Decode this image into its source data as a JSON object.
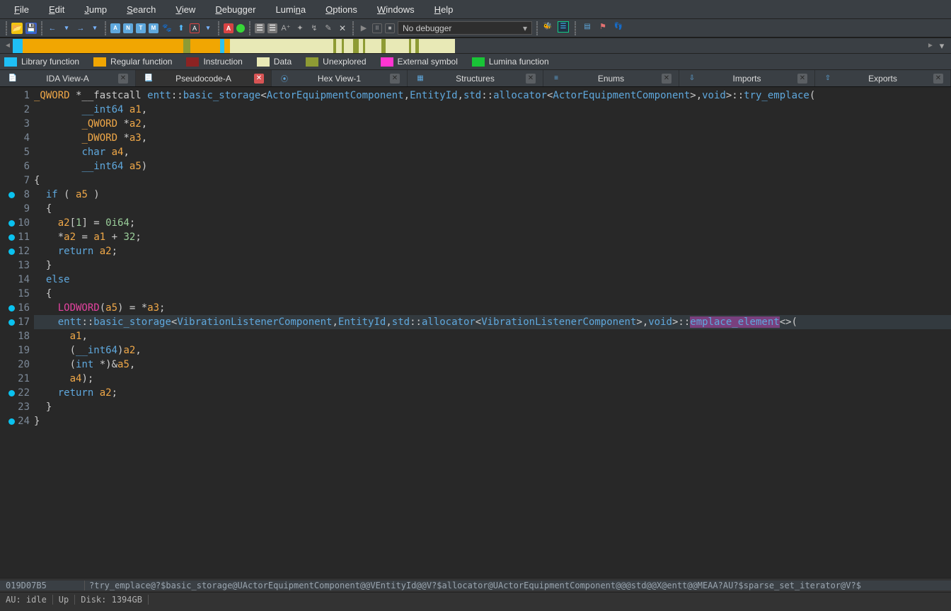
{
  "menu": [
    "File",
    "Edit",
    "Jump",
    "Search",
    "View",
    "Debugger",
    "Lumina",
    "Options",
    "Windows",
    "Help"
  ],
  "menuAccel": [
    0,
    0,
    0,
    0,
    0,
    0,
    4,
    0,
    0,
    0
  ],
  "debuggerField": "No debugger",
  "overview": [
    {
      "w": "2.2%",
      "c": "#1fbff5"
    },
    {
      "w": "35.2%",
      "c": "#f1a602"
    },
    {
      "w": "1.5%",
      "c": "#8e9b34"
    },
    {
      "w": "6.5%",
      "c": "#f1a602"
    },
    {
      "w": "1.0%",
      "c": "#2ec2f0"
    },
    {
      "w": "1.2%",
      "c": "#f1a602"
    },
    {
      "w": "22.7%",
      "c": "#e8e9b6"
    },
    {
      "w": "0.6%",
      "c": "#8e9b34"
    },
    {
      "w": "1.2%",
      "c": "#e8e9b6"
    },
    {
      "w": "0.5%",
      "c": "#8e9b34"
    },
    {
      "w": "2.0%",
      "c": "#e8e9b6"
    },
    {
      "w": "1.2%",
      "c": "#8e9b34"
    },
    {
      "w": "1.0%",
      "c": "#e8e9b6"
    },
    {
      "w": "0.5%",
      "c": "#8e9b34"
    },
    {
      "w": "3.5%",
      "c": "#e8e9b6"
    },
    {
      "w": "1.0%",
      "c": "#8e9b34"
    },
    {
      "w": "5.0%",
      "c": "#e8e9b6"
    },
    {
      "w": "0.5%",
      "c": "#8e9b34"
    },
    {
      "w": "1.0%",
      "c": "#e8e9b6"
    },
    {
      "w": "0.7%",
      "c": "#8e9b34"
    },
    {
      "w": "8.0%",
      "c": "#e8e9b6"
    }
  ],
  "legend": [
    {
      "c": "#1fbff5",
      "t": "Library function"
    },
    {
      "c": "#f1a602",
      "t": "Regular function"
    },
    {
      "c": "#8c2323",
      "t": "Instruction"
    },
    {
      "c": "#e8e9b6",
      "t": "Data"
    },
    {
      "c": "#8e9b34",
      "t": "Unexplored"
    },
    {
      "c": "#ff35d1",
      "t": "External symbol"
    },
    {
      "c": "#19c537",
      "t": "Lumina function"
    }
  ],
  "tabs": [
    {
      "label": "IDA View-A",
      "icon": "📄",
      "active": false
    },
    {
      "label": "Pseudocode-A",
      "icon": "📃",
      "active": true
    },
    {
      "label": "Hex View-1",
      "icon": "⦿",
      "active": false
    },
    {
      "label": "Structures",
      "icon": "▦",
      "active": false
    },
    {
      "label": "Enums",
      "icon": "≡",
      "active": false
    },
    {
      "label": "Imports",
      "icon": "⇩",
      "active": false
    },
    {
      "label": "Exports",
      "icon": "⇧",
      "active": false
    }
  ],
  "code": {
    "lines": [
      {
        "n": 1,
        "bp": false,
        "seg": [
          {
            "c": "t-gold",
            "t": "_QWORD"
          },
          {
            "c": "t-gray",
            "t": " *__fastcall "
          },
          {
            "c": "t-blue",
            "t": "entt"
          },
          {
            "c": "t-gray",
            "t": "::"
          },
          {
            "c": "t-blue",
            "t": "basic_storage"
          },
          {
            "c": "t-gray",
            "t": "<"
          },
          {
            "c": "t-blue",
            "t": "ActorEquipmentComponent"
          },
          {
            "c": "t-gray",
            "t": ","
          },
          {
            "c": "t-blue",
            "t": "EntityId"
          },
          {
            "c": "t-gray",
            "t": ","
          },
          {
            "c": "t-blue",
            "t": "std"
          },
          {
            "c": "t-gray",
            "t": "::"
          },
          {
            "c": "t-blue",
            "t": "allocator"
          },
          {
            "c": "t-gray",
            "t": "<"
          },
          {
            "c": "t-blue",
            "t": "ActorEquipmentComponent"
          },
          {
            "c": "t-gray",
            "t": ">,"
          },
          {
            "c": "t-blue",
            "t": "void"
          },
          {
            "c": "t-gray",
            "t": ">::"
          },
          {
            "c": "t-blue",
            "t": "try_emplace"
          },
          {
            "c": "t-gray",
            "t": "("
          }
        ]
      },
      {
        "n": 2,
        "bp": false,
        "seg": [
          {
            "c": "",
            "t": "        "
          },
          {
            "c": "t-blue",
            "t": "__int64"
          },
          {
            "c": "t-gray",
            "t": " "
          },
          {
            "c": "t-gold",
            "t": "a1"
          },
          {
            "c": "t-gray",
            "t": ","
          }
        ]
      },
      {
        "n": 3,
        "bp": false,
        "seg": [
          {
            "c": "",
            "t": "        "
          },
          {
            "c": "t-gold",
            "t": "_QWORD"
          },
          {
            "c": "t-gray",
            "t": " *"
          },
          {
            "c": "t-gold",
            "t": "a2"
          },
          {
            "c": "t-gray",
            "t": ","
          }
        ]
      },
      {
        "n": 4,
        "bp": false,
        "seg": [
          {
            "c": "",
            "t": "        "
          },
          {
            "c": "t-gold",
            "t": "_DWORD"
          },
          {
            "c": "t-gray",
            "t": " *"
          },
          {
            "c": "t-gold",
            "t": "a3"
          },
          {
            "c": "t-gray",
            "t": ","
          }
        ]
      },
      {
        "n": 5,
        "bp": false,
        "seg": [
          {
            "c": "",
            "t": "        "
          },
          {
            "c": "t-blue",
            "t": "char"
          },
          {
            "c": "t-gray",
            "t": " "
          },
          {
            "c": "t-gold",
            "t": "a4"
          },
          {
            "c": "t-gray",
            "t": ","
          }
        ]
      },
      {
        "n": 6,
        "bp": false,
        "seg": [
          {
            "c": "",
            "t": "        "
          },
          {
            "c": "t-blue",
            "t": "__int64"
          },
          {
            "c": "t-gray",
            "t": " "
          },
          {
            "c": "t-gold",
            "t": "a5"
          },
          {
            "c": "t-gray",
            "t": ")"
          }
        ]
      },
      {
        "n": 7,
        "bp": false,
        "seg": [
          {
            "c": "t-gray",
            "t": "{"
          }
        ]
      },
      {
        "n": 8,
        "bp": true,
        "seg": [
          {
            "c": "",
            "t": "  "
          },
          {
            "c": "t-blue",
            "t": "if"
          },
          {
            "c": "t-gray",
            "t": " ( "
          },
          {
            "c": "t-gold",
            "t": "a5"
          },
          {
            "c": "t-gray",
            "t": " )"
          }
        ]
      },
      {
        "n": 9,
        "bp": false,
        "seg": [
          {
            "c": "",
            "t": "  "
          },
          {
            "c": "t-gray",
            "t": "{"
          }
        ]
      },
      {
        "n": 10,
        "bp": true,
        "seg": [
          {
            "c": "",
            "t": "    "
          },
          {
            "c": "t-gold",
            "t": "a2"
          },
          {
            "c": "t-gray",
            "t": "["
          },
          {
            "c": "t-num",
            "t": "1"
          },
          {
            "c": "t-gray",
            "t": "] = "
          },
          {
            "c": "t-num",
            "t": "0i64"
          },
          {
            "c": "t-gray",
            "t": ";"
          }
        ]
      },
      {
        "n": 11,
        "bp": true,
        "seg": [
          {
            "c": "",
            "t": "    "
          },
          {
            "c": "t-gray",
            "t": "*"
          },
          {
            "c": "t-gold",
            "t": "a2"
          },
          {
            "c": "t-gray",
            "t": " = "
          },
          {
            "c": "t-gold",
            "t": "a1"
          },
          {
            "c": "t-gray",
            "t": " + "
          },
          {
            "c": "t-num",
            "t": "32"
          },
          {
            "c": "t-gray",
            "t": ";"
          }
        ]
      },
      {
        "n": 12,
        "bp": true,
        "seg": [
          {
            "c": "",
            "t": "    "
          },
          {
            "c": "t-blue",
            "t": "return"
          },
          {
            "c": "t-gray",
            "t": " "
          },
          {
            "c": "t-gold",
            "t": "a2"
          },
          {
            "c": "t-gray",
            "t": ";"
          }
        ]
      },
      {
        "n": 13,
        "bp": false,
        "seg": [
          {
            "c": "",
            "t": "  "
          },
          {
            "c": "t-gray",
            "t": "}"
          }
        ]
      },
      {
        "n": 14,
        "bp": false,
        "seg": [
          {
            "c": "",
            "t": "  "
          },
          {
            "c": "t-blue",
            "t": "else"
          }
        ]
      },
      {
        "n": 15,
        "bp": false,
        "seg": [
          {
            "c": "",
            "t": "  "
          },
          {
            "c": "t-gray",
            "t": "{"
          }
        ]
      },
      {
        "n": 16,
        "bp": true,
        "seg": [
          {
            "c": "",
            "t": "    "
          },
          {
            "c": "t-mag",
            "t": "LODWORD"
          },
          {
            "c": "t-gray",
            "t": "("
          },
          {
            "c": "t-gold",
            "t": "a5"
          },
          {
            "c": "t-gray",
            "t": ") = *"
          },
          {
            "c": "t-gold",
            "t": "a3"
          },
          {
            "c": "t-gray",
            "t": ";"
          }
        ]
      },
      {
        "n": 17,
        "bp": true,
        "hl": true,
        "seg": [
          {
            "c": "",
            "t": "    "
          },
          {
            "c": "t-blue",
            "t": "entt"
          },
          {
            "c": "t-gray",
            "t": "::"
          },
          {
            "c": "t-blue",
            "t": "basic_storage"
          },
          {
            "c": "t-gray",
            "t": "<"
          },
          {
            "c": "t-blue",
            "t": "VibrationListenerComponent"
          },
          {
            "c": "t-gray",
            "t": ","
          },
          {
            "c": "t-blue",
            "t": "EntityId"
          },
          {
            "c": "t-gray",
            "t": ","
          },
          {
            "c": "t-blue",
            "t": "std"
          },
          {
            "c": "t-gray",
            "t": "::"
          },
          {
            "c": "t-blue",
            "t": "allocator"
          },
          {
            "c": "t-gray",
            "t": "<"
          },
          {
            "c": "t-blue",
            "t": "VibrationListenerComponent"
          },
          {
            "c": "t-gray",
            "t": ">,"
          },
          {
            "c": "t-blue",
            "t": "void"
          },
          {
            "c": "t-gray",
            "t": ">::"
          },
          {
            "c": "t-blue sel",
            "t": "emplace_element"
          },
          {
            "c": "t-gray",
            "t": "<>("
          }
        ]
      },
      {
        "n": 18,
        "bp": false,
        "seg": [
          {
            "c": "",
            "t": "      "
          },
          {
            "c": "t-gold",
            "t": "a1"
          },
          {
            "c": "t-gray",
            "t": ","
          }
        ]
      },
      {
        "n": 19,
        "bp": false,
        "seg": [
          {
            "c": "",
            "t": "      "
          },
          {
            "c": "t-gray",
            "t": "("
          },
          {
            "c": "t-blue",
            "t": "__int64"
          },
          {
            "c": "t-gray",
            "t": ")"
          },
          {
            "c": "t-gold",
            "t": "a2"
          },
          {
            "c": "t-gray",
            "t": ","
          }
        ]
      },
      {
        "n": 20,
        "bp": false,
        "seg": [
          {
            "c": "",
            "t": "      "
          },
          {
            "c": "t-gray",
            "t": "("
          },
          {
            "c": "t-blue",
            "t": "int"
          },
          {
            "c": "t-gray",
            "t": " *)&"
          },
          {
            "c": "t-gold",
            "t": "a5"
          },
          {
            "c": "t-gray",
            "t": ","
          }
        ]
      },
      {
        "n": 21,
        "bp": false,
        "seg": [
          {
            "c": "",
            "t": "      "
          },
          {
            "c": "t-gold",
            "t": "a4"
          },
          {
            "c": "t-gray",
            "t": ");"
          }
        ]
      },
      {
        "n": 22,
        "bp": true,
        "seg": [
          {
            "c": "",
            "t": "    "
          },
          {
            "c": "t-blue",
            "t": "return"
          },
          {
            "c": "t-gray",
            "t": " "
          },
          {
            "c": "t-gold",
            "t": "a2"
          },
          {
            "c": "t-gray",
            "t": ";"
          }
        ]
      },
      {
        "n": 23,
        "bp": false,
        "seg": [
          {
            "c": "",
            "t": "  "
          },
          {
            "c": "t-gray",
            "t": "}"
          }
        ]
      },
      {
        "n": 24,
        "bp": true,
        "seg": [
          {
            "c": "t-gray",
            "t": "}"
          }
        ]
      }
    ]
  },
  "info": {
    "addr": "019D07B5",
    "sym": "?try_emplace@?$basic_storage@UActorEquipmentComponent@@VEntityId@@V?$allocator@UActorEquipmentComponent@@@std@@X@entt@@MEAA?AU?$sparse_set_iterator@V?$"
  },
  "status": {
    "au": "AU:  idle",
    "dir": "Up",
    "disk": "Disk: 1394GB"
  }
}
